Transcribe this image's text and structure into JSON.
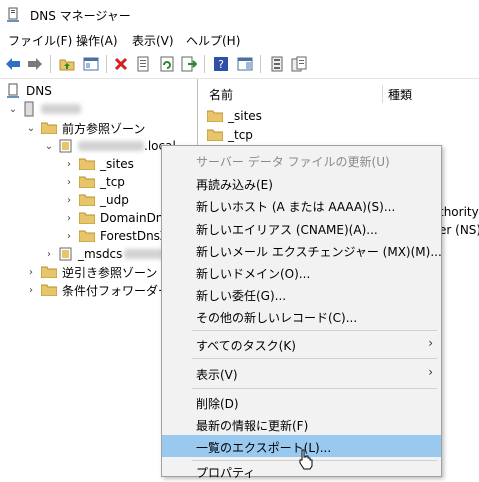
{
  "window": {
    "title": "DNS マネージャー"
  },
  "menu": [
    {
      "label": "ファイル(F)"
    },
    {
      "label": "操作(A)"
    },
    {
      "label": "表示(V)"
    },
    {
      "label": "ヘルプ(H)"
    }
  ],
  "toolbar": {
    "icons": [
      "back-icon",
      "forward-icon",
      "up-folder-icon",
      "show-hide-tree-icon",
      "delete-icon",
      "properties-icon",
      "refresh-icon",
      "export-icon",
      "help-icon",
      "action-pane-icon",
      "server-list-icon",
      "server-copy-icon"
    ]
  },
  "tree": {
    "root": "DNS",
    "forward_zones": "前方参照ゾーン",
    "zone_suffix": ".local",
    "sub_sites": "_sites",
    "sub_tcp": "_tcp",
    "sub_udp": "_udp",
    "sub_domaindns": "DomainDns",
    "sub_forestdns": "ForestDnsZ",
    "msdcs": "_msdcs",
    "reverse_zones": "逆引き参照ゾーン",
    "conditional_forwarders": "条件付フォワーダー"
  },
  "list": {
    "col_name": "名前",
    "col_type": "種類",
    "row_sites": "_sites",
    "row_tcp": "_tcp",
    "frag_authority": "thority",
    "frag_ns": "er (NS)"
  },
  "context_menu": {
    "update_server_data": "サーバー データ ファイルの更新(U)",
    "reload": "再読み込み(E)",
    "new_host": "新しいホスト (A または AAAA)(S)...",
    "new_alias": "新しいエイリアス (CNAME)(A)...",
    "new_mail_exchanger": "新しいメール エクスチェンジャー (MX)(M)...",
    "new_domain": "新しいドメイン(O)...",
    "new_delegation": "新しい委任(G)...",
    "other_new_records": "その他の新しいレコード(C)...",
    "all_tasks": "すべてのタスク(K)",
    "view": "表示(V)",
    "delete": "削除(D)",
    "refresh": "最新の情報に更新(F)",
    "export_list": "一覧のエクスポート(L)...",
    "properties": "プロパティ"
  },
  "colors": {
    "highlight": "#99c9ef",
    "folder": "#e8c46a",
    "menu_bg": "#f2f2f2"
  }
}
